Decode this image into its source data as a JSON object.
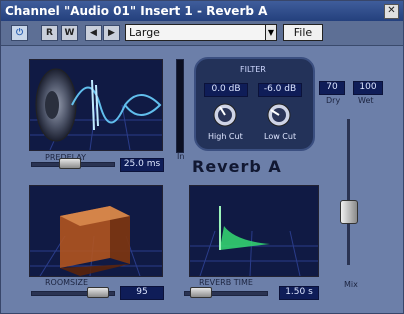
{
  "window": {
    "title": "Channel \"Audio 01\" Insert 1 - Reverb A"
  },
  "toolbar": {
    "power_icon": "power-icon",
    "read_label": "R",
    "write_label": "W",
    "prev_label": "◀",
    "next_label": "▶",
    "preset_value": "Large",
    "file_label": "File"
  },
  "predelay": {
    "label": "PREDELAY",
    "value": "25.0 ms",
    "level": 0.45
  },
  "in_label": "In",
  "filter": {
    "title": "FILTER",
    "highcut": {
      "value": "0.0 dB",
      "label": "High Cut"
    },
    "lowcut": {
      "value": "-6.0 dB",
      "label": "Low Cut"
    }
  },
  "drywet": {
    "dry_value": "70",
    "wet_value": "100",
    "dry_label": "Dry",
    "wet_label": "Wet"
  },
  "plugin_name": "Reverb A",
  "roomsize": {
    "label": "ROOMSIZE",
    "value": "95",
    "level": 0.9
  },
  "reverbtime": {
    "label": "REVERB TIME",
    "value": "1.50 s",
    "level": 0.1
  },
  "mix": {
    "label": "Mix",
    "level": 0.55
  },
  "colors": {
    "accent": "#233259",
    "display": "#0f1d58",
    "waveform": "#33d070"
  }
}
